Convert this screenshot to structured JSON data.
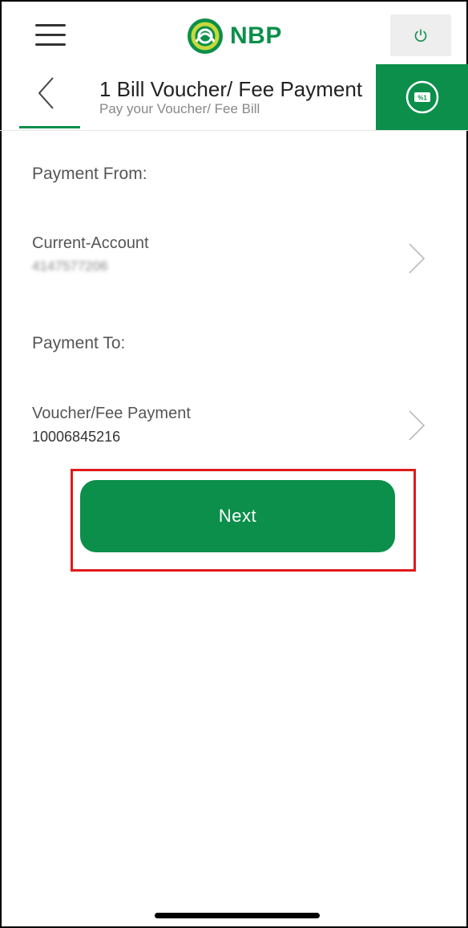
{
  "header": {
    "brand": "NBP",
    "menu_icon": "hamburger-menu-icon",
    "power_icon": "power-icon"
  },
  "subheader": {
    "title": "1 Bill Voucher/ Fee Payment",
    "subtitle": "Pay your Voucher/ Fee Bill",
    "back_icon": "chevron-left-icon",
    "tab_icon": "bill-percent-icon"
  },
  "payment_from": {
    "label": "Payment From:",
    "account_type": "Current-Account",
    "account_number": "4147577206"
  },
  "payment_to": {
    "label": "Payment To:",
    "payee": "Voucher/Fee Payment",
    "reference": "10006845216"
  },
  "actions": {
    "next_label": "Next"
  },
  "colors": {
    "brand_green": "#0b8f4a",
    "highlight_red": "#e01b1b"
  }
}
